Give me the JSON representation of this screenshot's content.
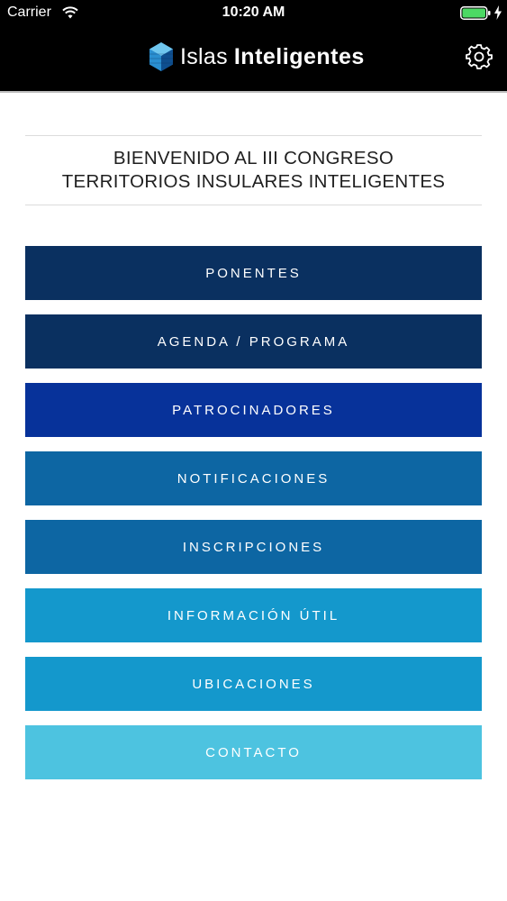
{
  "status": {
    "carrier": "Carrier",
    "time": "10:20 AM",
    "battery_color": "#4cd964"
  },
  "header": {
    "brand_light": "Islas",
    "brand_bold": "Inteligentes",
    "logo_icon": "hexagon-cube-icon",
    "settings_icon": "gear-icon"
  },
  "welcome": {
    "line1": "BIENVENIDO AL III CONGRESO",
    "line2": "TERRITORIOS INSULARES INTELIGENTES"
  },
  "menu": [
    {
      "label": "PONENTES",
      "color": "#0a3060"
    },
    {
      "label": "AGENDA / PROGRAMA",
      "color": "#0a3060"
    },
    {
      "label": "PATROCINADORES",
      "color": "#07329a"
    },
    {
      "label": "NOTIFICACIONES",
      "color": "#0d66a3"
    },
    {
      "label": "INSCRIPCIONES",
      "color": "#0d66a3"
    },
    {
      "label": "INFORMACIÓN ÚTIL",
      "color": "#1498cc"
    },
    {
      "label": "UBICACIONES",
      "color": "#1498cc"
    },
    {
      "label": "CONTACTO",
      "color": "#4dc3e0"
    }
  ]
}
